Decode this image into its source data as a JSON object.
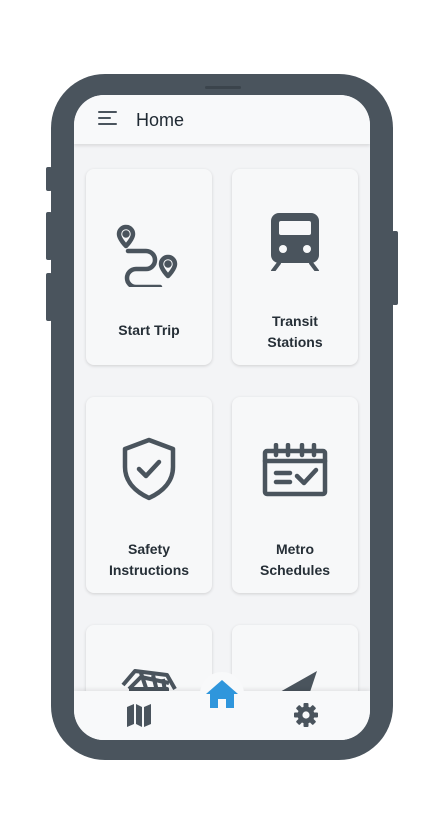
{
  "header": {
    "title": "Home"
  },
  "cards": [
    {
      "label_line1": "Start Trip",
      "label_line2": "",
      "icon": "route-icon"
    },
    {
      "label_line1": "Transit",
      "label_line2": "Stations",
      "icon": "train-icon"
    },
    {
      "label_line1": "Safety",
      "label_line2": "Instructions",
      "icon": "shield-check-icon"
    },
    {
      "label_line1": "Metro",
      "label_line2": "Schedules",
      "icon": "calendar-check-icon"
    },
    {
      "label_line1": "",
      "label_line2": "",
      "icon": "money-icon"
    },
    {
      "label_line1": "",
      "label_line2": "",
      "icon": "send-icon"
    }
  ],
  "bottom_nav": {
    "items": [
      {
        "icon": "map-icon"
      },
      {
        "icon": "home-icon",
        "active": true
      },
      {
        "icon": "gear-icon"
      }
    ]
  },
  "colors": {
    "accent": "#2f96dc",
    "icon": "#4a545d",
    "text": "#262f37"
  }
}
